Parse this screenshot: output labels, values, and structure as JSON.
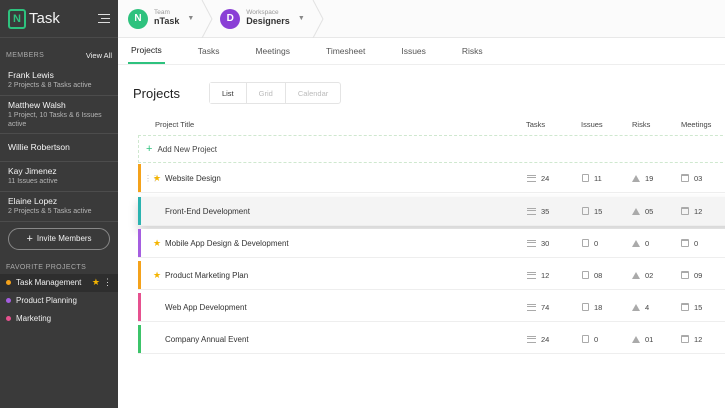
{
  "app": {
    "logo_glyph": "N",
    "name": "Task"
  },
  "sidebar": {
    "members_title": "MEMBERS",
    "view_all": "View All",
    "members": [
      {
        "name": "Frank Lewis",
        "sub": "2 Projects & 8 Tasks active"
      },
      {
        "name": "Matthew Walsh",
        "sub": "1 Project, 10 Tasks & 6 Issues active"
      },
      {
        "name": "Willie Robertson",
        "sub": ""
      },
      {
        "name": "Kay Jimenez",
        "sub": "11 Issues active"
      },
      {
        "name": "Elaine Lopez",
        "sub": "2 Projects & 5 Tasks active"
      }
    ],
    "invite_label": "Invite Members",
    "favorites_title": "FAVORITE PROJECTS",
    "favorites": [
      {
        "label": "Task Management",
        "color": "#f4a21b"
      },
      {
        "label": "Product Planning",
        "color": "#a55ee0"
      },
      {
        "label": "Marketing",
        "color": "#e6518f"
      }
    ]
  },
  "topbar": {
    "team_label": "Team",
    "team_value": "nTask",
    "team_avatar_glyph": "N",
    "team_color": "#2ec27e",
    "workspace_label": "Workspace",
    "workspace_value": "Designers",
    "workspace_initial": "D",
    "workspace_color": "#8a3fd6"
  },
  "tabs": [
    "Projects",
    "Tasks",
    "Meetings",
    "Timesheet",
    "Issues",
    "Risks"
  ],
  "page": {
    "title": "Projects",
    "views": [
      "List",
      "Grid",
      "Calendar"
    ]
  },
  "table": {
    "columns": {
      "title": "Project Title",
      "tasks": "Tasks",
      "issues": "Issues",
      "risks": "Risks",
      "meetings": "Meetings"
    },
    "add_label": "Add New Project",
    "rows": [
      {
        "title": "Website Design",
        "color": "#f4a21b",
        "starred": true,
        "tasks": "24",
        "issues": "11",
        "risks": "19",
        "meetings": "03"
      },
      {
        "title": "Front-End Development",
        "color": "#2bb3b0",
        "starred": false,
        "tasks": "35",
        "issues": "15",
        "risks": "05",
        "meetings": "12"
      },
      {
        "title": "Mobile App Design & Development",
        "color": "#a55ee0",
        "starred": true,
        "tasks": "30",
        "issues": "0",
        "risks": "0",
        "meetings": "0"
      },
      {
        "title": "Product Marketing Plan",
        "color": "#f4a21b",
        "starred": true,
        "tasks": "12",
        "issues": "08",
        "risks": "02",
        "meetings": "09"
      },
      {
        "title": "Web App Development",
        "color": "#e6518f",
        "starred": false,
        "tasks": "74",
        "issues": "18",
        "risks": "4",
        "meetings": "15"
      },
      {
        "title": "Company Annual Event",
        "color": "#3cc46a",
        "starred": false,
        "tasks": "24",
        "issues": "0",
        "risks": "01",
        "meetings": "12"
      }
    ]
  },
  "icons": {
    "star": "star-icon",
    "grip": "drag-handle-icon",
    "task": "tasks-icon",
    "issue": "issue-icon",
    "risk": "risk-warning-icon",
    "meeting": "calendar-icon"
  }
}
